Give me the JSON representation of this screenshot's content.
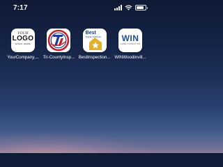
{
  "status_bar": {
    "time": "7:17",
    "icons": [
      "signal-icon",
      "wifi-icon",
      "battery-icon"
    ],
    "battery_level": 0.85
  },
  "apps": [
    {
      "label": "YourCompany,...",
      "logo_lines": [
        "YOUR",
        "LOGO",
        "GOES HERE"
      ]
    },
    {
      "label": "Tri-CountyInsp...",
      "logo_lines": [
        "TI"
      ]
    },
    {
      "label": "BestInspection...",
      "logo_lines": [
        "Best",
        "INSPECTIONS INC"
      ]
    },
    {
      "label": "WINWoodinvill...",
      "logo_lines": [
        "WIN",
        "HOME INSPECTION"
      ]
    }
  ],
  "colors": {
    "wallpaper_top": "#0f1a34",
    "wallpaper_bottom": "#8a7a98",
    "tri_county_red": "#c8202b",
    "tri_county_blue": "#1c3d8f",
    "best_blue": "#153e8a",
    "best_gold": "#e3b02c",
    "win_blue": "#1f4e8c"
  }
}
